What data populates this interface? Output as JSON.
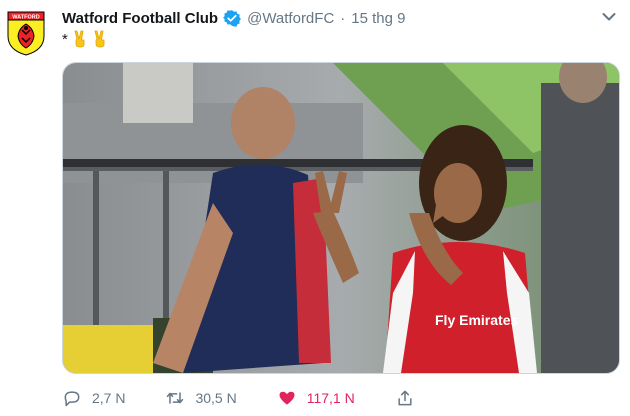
{
  "tweet": {
    "display_name": "Watford Football Club",
    "handle": "@WatfordFC",
    "separator": "·",
    "timestamp": "15 thg 9",
    "text_prefix": "*",
    "avatar_logo_text": "WATFORD",
    "verified": true,
    "colors": {
      "accent": "#1da1f2",
      "like": "#e0245e",
      "muted": "#657786",
      "name": "#14171a",
      "watford_yellow": "#fbee23",
      "watford_red": "#ed2127"
    }
  },
  "media": {
    "type": "video-frame",
    "kit_sponsor_text": "Fly Emirates"
  },
  "actions": {
    "reply_count": "2,7 N",
    "retweet_count": "30,5 N",
    "like_count": "117,1 N"
  }
}
